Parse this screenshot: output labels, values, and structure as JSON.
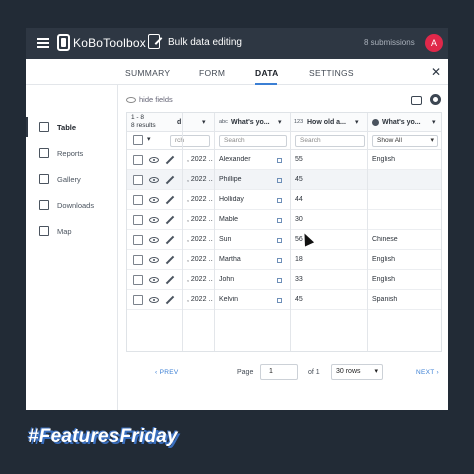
{
  "topbar": {
    "logo_text": "KoBoToolbox",
    "title": "Bulk data editing",
    "submissions": "8 submissions",
    "avatar_letter": "A"
  },
  "tabs": [
    "SUMMARY",
    "FORM",
    "DATA",
    "SETTINGS"
  ],
  "active_tab": "DATA",
  "sidebar": {
    "items": [
      {
        "label": "Table",
        "icon": "table-icon"
      },
      {
        "label": "Reports",
        "icon": "reports-icon"
      },
      {
        "label": "Gallery",
        "icon": "gallery-icon"
      },
      {
        "label": "Downloads",
        "icon": "download-icon"
      },
      {
        "label": "Map",
        "icon": "map-icon"
      }
    ]
  },
  "toolbar": {
    "hide_fields": "hide fields"
  },
  "table": {
    "range": "1 - 8",
    "results": "8 results",
    "columns": [
      {
        "label": "d"
      },
      {
        "type": "abc",
        "label": "What's yo..."
      },
      {
        "type": "123",
        "label": "How old a..."
      },
      {
        "label": "What's yo..."
      }
    ],
    "filters": {
      "search1": "rch",
      "search2": "Search",
      "search3": "Search",
      "select": "Show All"
    },
    "rows": [
      {
        "date": ", 2022 ...",
        "name": "Alexander",
        "age": "55",
        "lang": "English"
      },
      {
        "date": ", 2022 ...",
        "name": "Phillipe",
        "age": "45",
        "lang": ""
      },
      {
        "date": ", 2022 ...",
        "name": "Holliday",
        "age": "44",
        "lang": ""
      },
      {
        "date": ", 2022 ...",
        "name": "Mable",
        "age": "30",
        "lang": ""
      },
      {
        "date": ", 2022 ...",
        "name": "Sun",
        "age": "56",
        "lang": "Chinese"
      },
      {
        "date": ", 2022 ...",
        "name": "Martha",
        "age": "18",
        "lang": "English"
      },
      {
        "date": ", 2022 ...",
        "name": "John",
        "age": "33",
        "lang": "English"
      },
      {
        "date": ", 2022 ...",
        "name": "Kelvin",
        "age": "45",
        "lang": "Spanish"
      }
    ]
  },
  "pager": {
    "prev": "PREV",
    "page_label": "Page",
    "page_value": "1",
    "of": "of 1",
    "rows": "30 rows",
    "next": "NEXT"
  },
  "hashtag": "#FeaturesFriday"
}
